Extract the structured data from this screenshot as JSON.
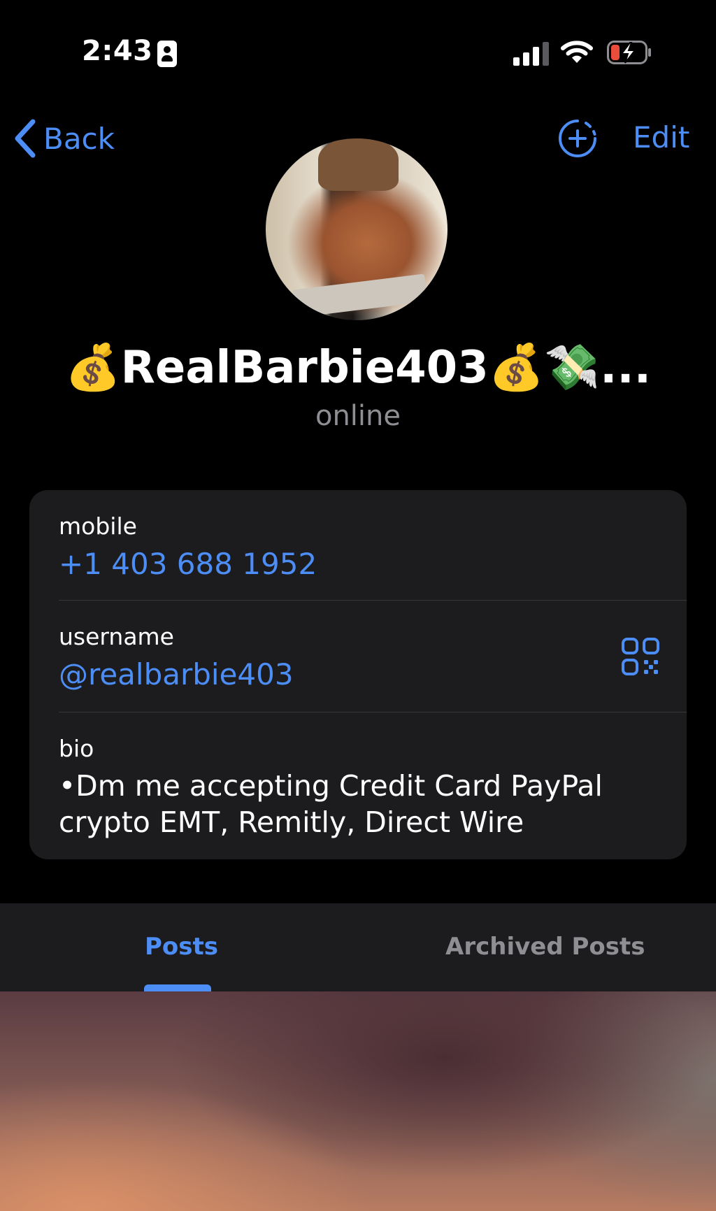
{
  "status_bar": {
    "time": "2:43"
  },
  "nav": {
    "back_label": "Back",
    "edit_label": "Edit"
  },
  "profile": {
    "display_name": "💰RealBarbie403💰💸...",
    "status": "online"
  },
  "info": {
    "mobile_label": "mobile",
    "mobile_value": "+1 403 688 1952",
    "username_label": "username",
    "username_value": "@realbarbie403",
    "bio_label": "bio",
    "bio_value": "•Dm me accepting Credit Card PayPal crypto EMT, Remitly, Direct Wire"
  },
  "tabs": [
    {
      "label": "Posts",
      "selected": true
    },
    {
      "label": "Archived Posts",
      "selected": false
    }
  ],
  "colors": {
    "accent": "#4d8df6",
    "background": "#000000",
    "card": "#1c1c1e",
    "secondary_text": "#8e8e93",
    "battery_low": "#eb4d3d"
  },
  "icons": {
    "back": "chevron-left-icon",
    "add_story": "add-story-icon",
    "qr": "qr-code-icon",
    "signal": "cellular-signal-icon",
    "wifi": "wifi-icon",
    "battery": "battery-charging-icon"
  }
}
